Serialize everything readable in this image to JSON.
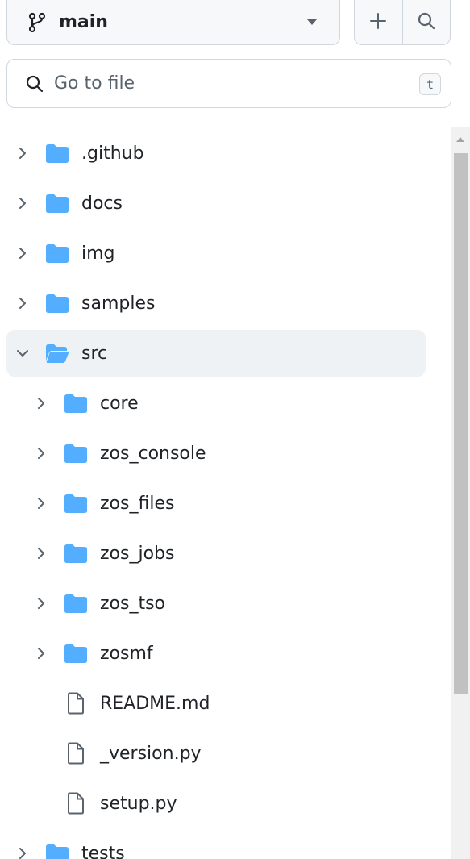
{
  "branch": {
    "label": "main"
  },
  "search": {
    "placeholder": "Go to file",
    "shortcut": "t"
  },
  "colors": {
    "folder": "#54aeff",
    "text": "#1f2328",
    "muted": "#59636e",
    "border": "#d0d7de"
  },
  "tree": [
    {
      "label": ".github",
      "type": "folder",
      "depth": 0,
      "expanded": false
    },
    {
      "label": "docs",
      "type": "folder",
      "depth": 0,
      "expanded": false
    },
    {
      "label": "img",
      "type": "folder",
      "depth": 0,
      "expanded": false
    },
    {
      "label": "samples",
      "type": "folder",
      "depth": 0,
      "expanded": false
    },
    {
      "label": "src",
      "type": "folder",
      "depth": 0,
      "expanded": true,
      "selected": true
    },
    {
      "label": "core",
      "type": "folder",
      "depth": 1,
      "expanded": false
    },
    {
      "label": "zos_console",
      "type": "folder",
      "depth": 1,
      "expanded": false
    },
    {
      "label": "zos_files",
      "type": "folder",
      "depth": 1,
      "expanded": false
    },
    {
      "label": "zos_jobs",
      "type": "folder",
      "depth": 1,
      "expanded": false
    },
    {
      "label": "zos_tso",
      "type": "folder",
      "depth": 1,
      "expanded": false
    },
    {
      "label": "zosmf",
      "type": "folder",
      "depth": 1,
      "expanded": false
    },
    {
      "label": "README.md",
      "type": "file",
      "depth": 1
    },
    {
      "label": "_version.py",
      "type": "file",
      "depth": 1
    },
    {
      "label": "setup.py",
      "type": "file",
      "depth": 1
    },
    {
      "label": "tests",
      "type": "folder",
      "depth": 0,
      "expanded": false
    }
  ]
}
